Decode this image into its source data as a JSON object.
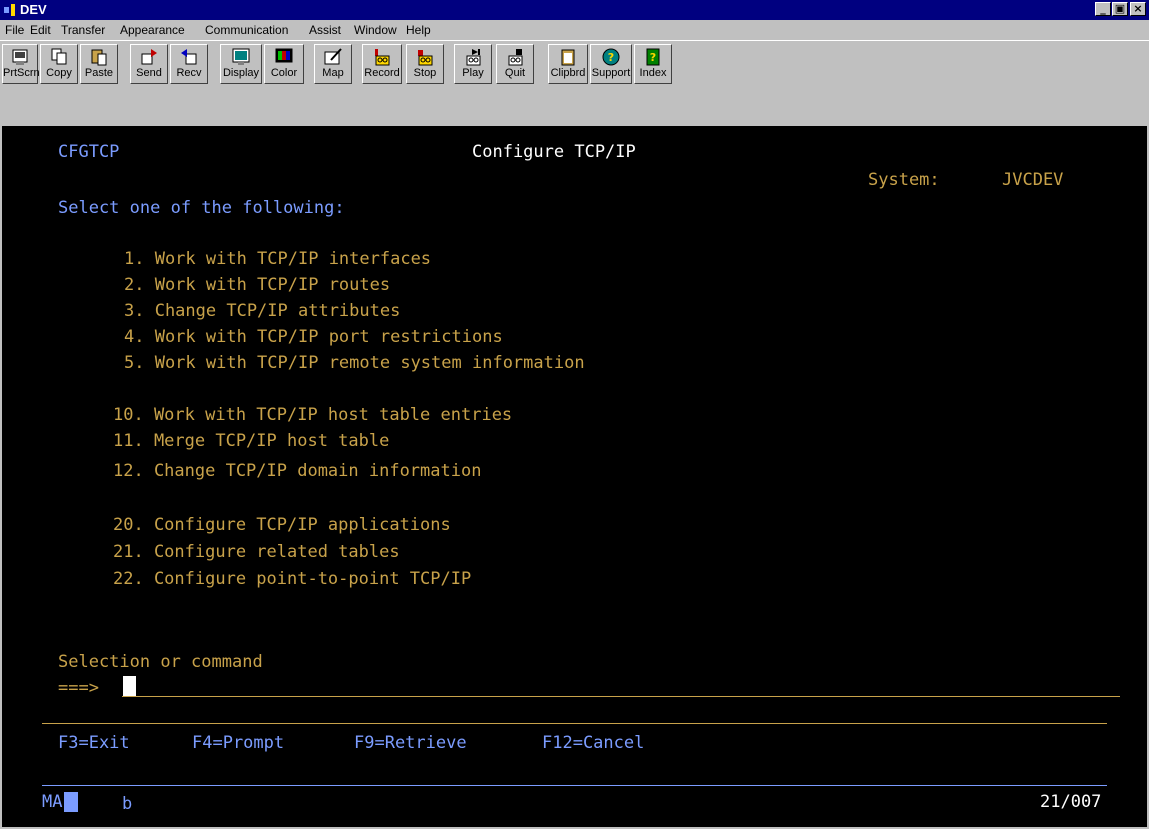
{
  "window": {
    "title": "DEV"
  },
  "menu": [
    "File",
    "Edit",
    "Transfer",
    "Appearance",
    "Communication",
    "Assist",
    "Window",
    "Help"
  ],
  "toolbar": [
    {
      "label": "PrtScrn",
      "icon": "print-screen-icon"
    },
    {
      "label": "Copy",
      "icon": "copy-icon"
    },
    {
      "label": "Paste",
      "icon": "paste-icon"
    },
    {
      "label": "Send",
      "icon": "send-icon"
    },
    {
      "label": "Recv",
      "icon": "receive-icon"
    },
    {
      "label": "Display",
      "icon": "display-icon"
    },
    {
      "label": "Color",
      "icon": "color-icon"
    },
    {
      "label": "Map",
      "icon": "map-icon"
    },
    {
      "label": "Record",
      "icon": "record-icon"
    },
    {
      "label": "Stop",
      "icon": "stop-icon"
    },
    {
      "label": "Play",
      "icon": "play-icon"
    },
    {
      "label": "Quit",
      "icon": "quit-icon"
    },
    {
      "label": "Clipbrd",
      "icon": "clipboard-icon"
    },
    {
      "label": "Support",
      "icon": "support-icon"
    },
    {
      "label": "Index",
      "icon": "index-icon"
    }
  ],
  "screen": {
    "program": "CFGTCP",
    "title": "Configure TCP/IP",
    "system_label": "System:",
    "system_name": "JVCDEV",
    "prompt": "Select one of the following:",
    "options": [
      "1. Work with TCP/IP interfaces",
      "2. Work with TCP/IP routes",
      "3. Change TCP/IP attributes",
      "4. Work with TCP/IP port restrictions",
      "5. Work with TCP/IP remote system information",
      "10. Work with TCP/IP host table entries",
      "11. Merge TCP/IP host table",
      "12. Change TCP/IP domain information",
      "20. Configure TCP/IP applications",
      "21. Configure related tables",
      "22. Configure point-to-point TCP/IP"
    ],
    "selection_label": "Selection or command",
    "command_arrow": "===>",
    "function_keys": [
      "F3=Exit",
      "F4=Prompt",
      "F9=Retrieve",
      "F12=Cancel"
    ],
    "status_left": "MA",
    "status_mid": "b",
    "status_pos": "21/007"
  },
  "colors": {
    "blue_text": "#7b9cff",
    "yellow_text": "#c8a24a",
    "titlebar": "#000080"
  }
}
